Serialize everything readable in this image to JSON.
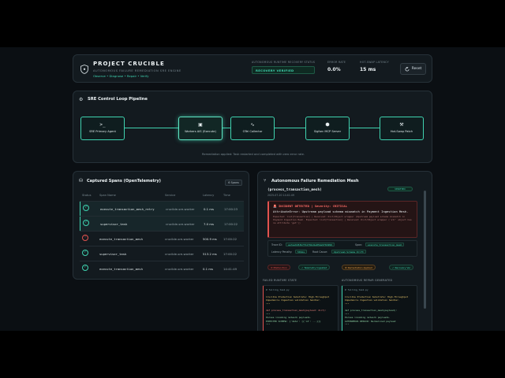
{
  "header": {
    "title": "PROJECT CRUCIBLE",
    "subtitle": "AUTONOMOUS FAILURE REMEDIATION SRE ENGINE",
    "links": "Observe • Diagnose • Repair • Verify",
    "status_label": "AUTONOMOUS RUNTIME RECOVERY STATUS",
    "status_value": "RECOVERY VERIFIED",
    "error_rate_label": "ERROR RATE",
    "error_rate_value": "0.0%",
    "latency_label": "HOT-SWAP LATENCY",
    "latency_value": "15 ms",
    "reset_label": "Reset"
  },
  "pipeline": {
    "title": "SRE Control Loop Pipeline",
    "nodes": [
      {
        "label": "SRE Primary Agent",
        "icon": "terminal-icon"
      },
      {
        "label": "Workers AIS (Execute)",
        "icon": "cpu-icon"
      },
      {
        "label": "OTel Collector",
        "icon": "activity-icon"
      },
      {
        "label": "Sigforc MCP Server",
        "icon": "server-icon"
      },
      {
        "label": "Hot-Swap Patch",
        "icon": "wrench-icon"
      }
    ],
    "note": "Remediation applied: Task restarted and completed with zero error rate."
  },
  "spans": {
    "title": "Captured Spans (OpenTelemetry)",
    "count": "6 Spans",
    "columns": [
      "Status",
      "Span Name",
      "Service",
      "Latency",
      "Time"
    ],
    "rows": [
      {
        "status": "ok",
        "name": "execute_transaction_mesh_retry",
        "service": "crucible-sre-worker",
        "latency": "0.1 ms",
        "time": "17:00:23"
      },
      {
        "status": "ok",
        "name": "supervisor_task",
        "service": "crucible-sre-worker",
        "latency": "7.0 ms",
        "time": "17:00:22"
      },
      {
        "status": "error",
        "name": "execute_transaction_mesh",
        "service": "crucible-sre-worker",
        "latency": "500.9 ms",
        "time": "17:00:22"
      },
      {
        "status": "ok",
        "name": "supervisor_task",
        "service": "crucible-sre-worker",
        "latency": "513.2 ms",
        "time": "17:00:22"
      },
      {
        "status": "ok",
        "name": "execute_transaction_mesh",
        "service": "crucible-sre-worker",
        "latency": "0.1 ms",
        "time": "14:41:49"
      }
    ]
  },
  "remediation": {
    "title": "Autonomous Failure Remediation Mesh",
    "function_name": "(process_transaction_mesh)",
    "timestamp": "2025-07-20 14:41:49",
    "verified": "VERIFIED",
    "incident_title": "INCIDENT DETECTED | Severity: CRITICAL",
    "incident_error": "AttributeError: Upstream payload schema mismatch in Payment Ingestion Mesh.",
    "incident_trace": "Expected: list[Transaction] | Received: Dict/Object wrapper (Upstream payload schema mismatch in Payment Ingestion Mesh. Expected: list[Transaction] | Received: Dict/Object wrapper ('str' object has no attribute 'get'))",
    "trace_label": "Trace ID:",
    "trace_id": "ee7ae9d53b7fb1f9bd1e85ba9f8d999",
    "span_label": "Span:",
    "span_value": "execute_transaction_mesh",
    "latency_label": "Latency Penalty:",
    "latency_value": "501ms",
    "root_label": "Root Cause:",
    "root_value": "Upstream Schema Drift",
    "steps": [
      {
        "label": "Misfunction",
        "color": "#e2534f"
      },
      {
        "label": "Telemetry Ingested",
        "color": "#3fd3b0"
      },
      {
        "label": "Remediation Applied",
        "color": "#e8a04a"
      },
      {
        "label": "Recovery Ver",
        "color": "#3fd3b0"
      }
    ],
    "failed_heading": "FAILED RUNTIME STATE",
    "repair_heading": "AUTONOMOUS REPAIR GENERATED",
    "failed_code": [
      "# failing_task.py",
      "",
      "Crucible Production Substrate: High-Throughput",
      "Impedancis Ingestion validation handler.",
      "\"\"\"",
      "",
      "def process_transaction_mesh(payload: dict):",
      "  \"\"\"",
      "    Parses incoming network payloads.",
      "    EXPECTED SCHEMA: {'data': [{'id': ...}]}",
      "  \"\"\""
    ],
    "repair_code": [
      "# failing_task.py",
      "",
      "Crucible Production Substrate: High-Throughput",
      "Impedancis Ingestion validation handler.",
      "\"\"\"",
      "",
      "def process_transaction_mesh(payload):",
      "  \"\"\"",
      "    Parses incoming network payloads.",
      "    AUTONOMOUS REPAIR: Normalized payload",
      "  \"\"\""
    ]
  }
}
